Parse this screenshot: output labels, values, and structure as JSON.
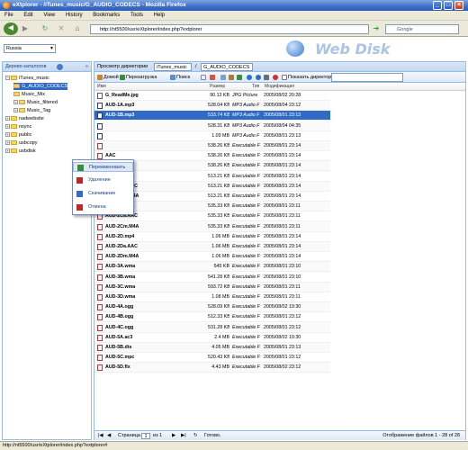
{
  "window": {
    "title": "eXtplorer - /iTunes_music/G_AUDIO_CODECS - Mozilla Firefox",
    "min": "_",
    "max": "□",
    "close": "×"
  },
  "menu": [
    "File",
    "Edit",
    "View",
    "History",
    "Bookmarks",
    "Tools",
    "Help"
  ],
  "nav": {
    "url": "http://nt5500/usr/eXtplorer/index.php?extplorer",
    "search_placeholder": "Google",
    "back": "◀",
    "fwd": "▶",
    "reload": "↻",
    "stop": "✕",
    "home": "⌂",
    "go": "➔"
  },
  "header": {
    "language": "Russia",
    "logo_text": "Web Disk"
  },
  "left": {
    "title": "Дерево каталогов",
    "tree": [
      {
        "label": "iTunes_music",
        "level": 0,
        "toggle": "−"
      },
      {
        "label": "G_AUDIO_CODECS",
        "level": 1,
        "toggle": "",
        "selected": true
      },
      {
        "label": "Music_Mix",
        "level": 1,
        "toggle": ""
      },
      {
        "label": "Music_filtered",
        "level": 1,
        "toggle": "+"
      },
      {
        "label": "Music_Tag",
        "level": 1,
        "toggle": "+"
      },
      {
        "label": "nadwebsite",
        "level": 0,
        "toggle": "+"
      },
      {
        "label": "nsync",
        "level": 0,
        "toggle": "+"
      },
      {
        "label": "public",
        "level": 0,
        "toggle": "+"
      },
      {
        "label": "usbcopy",
        "level": 0,
        "toggle": "+"
      },
      {
        "label": "usbdisk",
        "level": 0,
        "toggle": "+"
      }
    ]
  },
  "right": {
    "path_label": "Просмотр директории",
    "path_root": "iTunes_music",
    "path_sep": "/",
    "path_current": "G_AUDIO_CODECS",
    "toolbar": {
      "home": "Домой",
      "reload": "Перезагрузка",
      "search": "Поиск",
      "show_dirs": "Показать директории"
    },
    "columns": {
      "name": "Имя",
      "size": "Размер",
      "type": "Тип",
      "modified": "Модификация"
    },
    "files": [
      {
        "name": "G_ReadMe.jpg",
        "size": "90.13 KB",
        "type": "JPG Picture",
        "mod": "2005/08/02 20:28",
        "kind": "jpg"
      },
      {
        "name": "AUD-1A.mp3",
        "size": "528.04 KB",
        "type": "MP3 Audio F",
        "mod": "2005/08/04 23:12",
        "kind": "mp3"
      },
      {
        "name": "AUD-1B.mp3",
        "size": "533.74 KB",
        "type": "MP3 Audio F",
        "mod": "2005/08/01 23:13",
        "kind": "mp3",
        "selected": true
      },
      {
        "name": "",
        "size": "528.31 KB",
        "type": "MP3 Audio F",
        "mod": "2005/08/04 04:35",
        "kind": "mp3"
      },
      {
        "name": "",
        "size": "1.09 MB",
        "type": "MP3 Audio F",
        "mod": "2005/08/01 23:13",
        "kind": "mp3"
      },
      {
        "name": "",
        "size": "538.26 KB",
        "type": "Executable F",
        "mod": "2005/08/01 23:14",
        "kind": "exe"
      },
      {
        "name": "AAC",
        "size": "538.26 KB",
        "type": "Executable F",
        "mod": "2005/08/01 23:14",
        "kind": "exe"
      },
      {
        "name": "M4A",
        "size": "538.26 KB",
        "type": "Executable F",
        "mod": "2005/08/01 23:14",
        "kind": "exe"
      },
      {
        "name": "AUD-2B.mp4",
        "size": "513.21 KB",
        "type": "Executable F",
        "mod": "2005/08/01 23:14",
        "kind": "exe"
      },
      {
        "name": "AUD-2Ba.AAC",
        "size": "513.21 KB",
        "type": "Executable F",
        "mod": "2005/08/01 23:14",
        "kind": "exe"
      },
      {
        "name": "AUD-2Bm.M4A",
        "size": "513.21 KB",
        "type": "Executable F",
        "mod": "2005/08/01 23:14",
        "kind": "exe"
      },
      {
        "name": "AUD-2C.mp4",
        "size": "535.33 KB",
        "type": "Executable F",
        "mod": "2005/08/01 23:11",
        "kind": "exe"
      },
      {
        "name": "AUD-2Ca.AAC",
        "size": "535.33 KB",
        "type": "Executable F",
        "mod": "2005/08/01 23:11",
        "kind": "exe"
      },
      {
        "name": "AUD-2Cm.M4A",
        "size": "535.33 KB",
        "type": "Executable F",
        "mod": "2005/08/01 23:11",
        "kind": "exe"
      },
      {
        "name": "AUD-2D.mp4",
        "size": "1.06 MB",
        "type": "Executable F",
        "mod": "2005/08/01 23:14",
        "kind": "exe"
      },
      {
        "name": "AUD-2Da.AAC",
        "size": "1.06 MB",
        "type": "Executable F",
        "mod": "2005/08/01 23:14",
        "kind": "exe"
      },
      {
        "name": "AUD-2Dm.M4A",
        "size": "1.06 MB",
        "type": "Executable F",
        "mod": "2005/08/01 23:14",
        "kind": "exe"
      },
      {
        "name": "AUD-3A.wma",
        "size": "545 KB",
        "type": "Executable F",
        "mod": "2005/08/01 23:10",
        "kind": "exe"
      },
      {
        "name": "AUD-3B.wma",
        "size": "541.28 KB",
        "type": "Executable F",
        "mod": "2005/08/01 23:10",
        "kind": "exe"
      },
      {
        "name": "AUD-3C.wma",
        "size": "593.72 KB",
        "type": "Executable F",
        "mod": "2005/08/01 23:11",
        "kind": "exe"
      },
      {
        "name": "AUD-3D.wma",
        "size": "1.08 MB",
        "type": "Executable F",
        "mod": "2005/08/01 23:11",
        "kind": "exe"
      },
      {
        "name": "AUD-4A.ogg",
        "size": "528.09 KB",
        "type": "Executable F",
        "mod": "2005/08/02 19:30",
        "kind": "exe"
      },
      {
        "name": "AUD-4B.ogg",
        "size": "512.33 KB",
        "type": "Executable F",
        "mod": "2005/08/01 23:12",
        "kind": "exe"
      },
      {
        "name": "AUD-4C.ogg",
        "size": "531.28 KB",
        "type": "Executable F",
        "mod": "2005/08/01 23:12",
        "kind": "exe"
      },
      {
        "name": "AUD-5A.ac3",
        "size": "2.4 MB",
        "type": "Executable F",
        "mod": "2005/08/02 19:30",
        "kind": "exe"
      },
      {
        "name": "AUD-5B.dts",
        "size": "4.05 MB",
        "type": "Executable F",
        "mod": "2005/08/01 23:13",
        "kind": "exe"
      },
      {
        "name": "AUD-5C.mpc",
        "size": "520.43 KB",
        "type": "Executable F",
        "mod": "2005/08/01 23:12",
        "kind": "exe"
      },
      {
        "name": "AUD-5D.flx",
        "size": "4.43 MB",
        "type": "Executable F",
        "mod": "2005/08/02 23:12",
        "kind": "exe"
      }
    ],
    "status": {
      "page_label": "Страница",
      "page": "1",
      "of": "из 1",
      "done": "Готово.",
      "summary": "Отображение файлов 1 - 28 of 28"
    }
  },
  "context_menu": [
    {
      "label": "Переименовать",
      "icon": "rename-icon",
      "color": "#3a8a3a",
      "highlight": true
    },
    {
      "label": "Удаление",
      "icon": "delete-icon",
      "color": "#cc2222"
    },
    {
      "label": "Скачивание",
      "icon": "download-icon",
      "color": "#2d6dcc"
    },
    {
      "label": "Отмена",
      "icon": "cancel-icon",
      "color": "#cc2222"
    }
  ],
  "browser_status": "http://nt5500/usr/eXtplorer/index.php?extplorer#"
}
